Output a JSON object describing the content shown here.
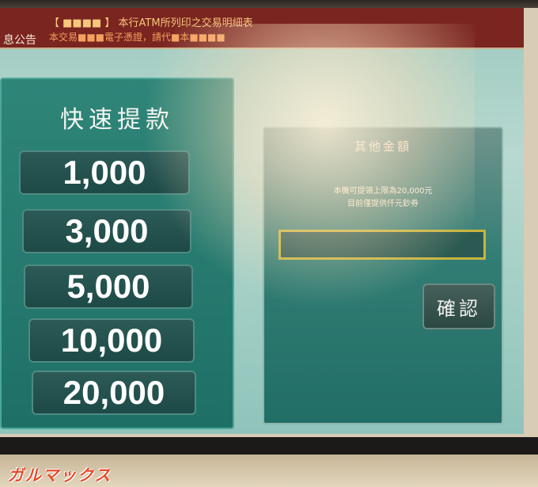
{
  "ticker": {
    "label": "息公告",
    "line1": "【 ■■■■ 】 本行ATM所列印之交易明細表",
    "line2": "本交易■■■電子憑證，請代■本■■■■"
  },
  "quick_withdraw": {
    "title": "快速提款",
    "amounts": [
      "1,000",
      "3,000",
      "5,000",
      "10,000",
      "20,000"
    ]
  },
  "other_amount": {
    "title": "其他金額",
    "limit_line1": "本機可提領上限為20,000元",
    "limit_line2": "目前僅提供仟元鈔券",
    "input_value": "",
    "confirm_label": "確認"
  },
  "watermark": "ガルマックス",
  "colors": {
    "ticker_bg": "#7a2520",
    "panel_teal": "#1e7066",
    "input_border": "#c9b53d"
  }
}
